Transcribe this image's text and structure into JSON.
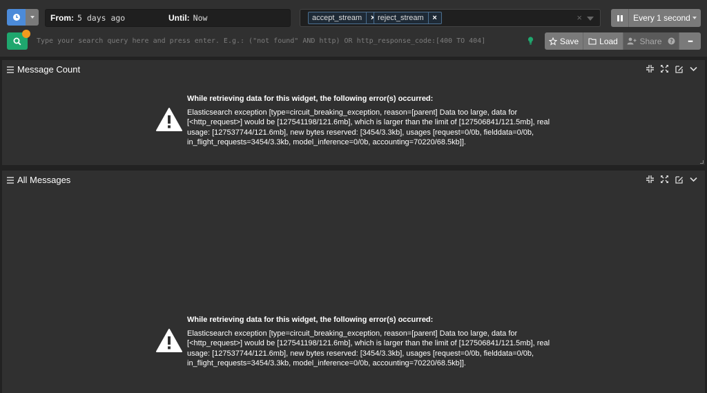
{
  "timerange": {
    "from_label": "From:",
    "from_value": "5 days ago",
    "until_label": "Until:",
    "until_value": "Now"
  },
  "streams": {
    "chips": [
      "accept_stream",
      "reject_stream"
    ],
    "remove_glyph": "×"
  },
  "refresh": {
    "interval_label": "Every 1 second"
  },
  "search": {
    "placeholder": "Type your search query here and press enter. E.g.: (\"not found\" AND http) OR http_response_code:[400 TO 404]"
  },
  "actions": {
    "save": "Save",
    "load": "Load",
    "share": "Share",
    "more": "•••"
  },
  "widgets": [
    {
      "title": "Message Count",
      "error_heading": "While retrieving data for this widget, the following error(s) occurred:",
      "error_text": "Elasticsearch exception [type=circuit_breaking_exception, reason=[parent] Data too large, data for [<http_request>] would be [127541198/121.6mb], which is larger than the limit of [127506841/121.5mb], real usage: [127537744/121.6mb], new bytes reserved: [3454/3.3kb], usages [request=0/0b, fielddata=0/0b, in_flight_requests=3454/3.3kb, model_inference=0/0b, accounting=70220/68.5kb]]."
    },
    {
      "title": "All Messages",
      "error_heading": "While retrieving data for this widget, the following error(s) occurred:",
      "error_text": "Elasticsearch exception [type=circuit_breaking_exception, reason=[parent] Data too large, data for [<http_request>] would be [127541198/121.6mb], which is larger than the limit of [127506841/121.5mb], real usage: [127537744/121.6mb], new bytes reserved: [3454/3.3kb], usages [request=0/0b, fielddata=0/0b, in_flight_requests=3454/3.3kb, model_inference=0/0b, accounting=70220/68.5kb]]."
    }
  ],
  "colors": {
    "accent_blue": "#4c8bd9",
    "search_green": "#1fa76e",
    "notify_orange": "#f29a1e"
  }
}
